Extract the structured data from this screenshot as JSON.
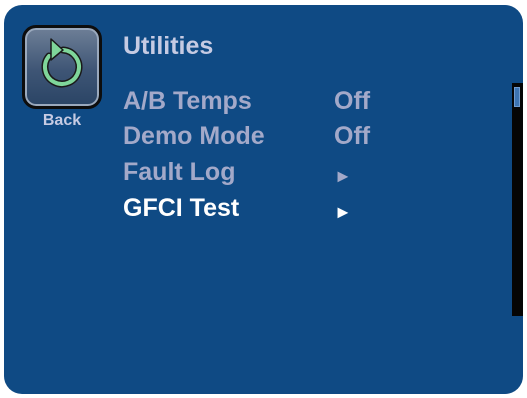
{
  "screen": {
    "title": "Utilities",
    "back": {
      "label": "Back",
      "icon": "back-arrow-icon"
    },
    "menu": [
      {
        "label": "A/B Temps",
        "value": "Off",
        "selected": false
      },
      {
        "label": "Demo Mode",
        "value": "Off",
        "selected": false
      },
      {
        "label": "Fault Log",
        "value": "",
        "arrow": "►",
        "selected": false
      },
      {
        "label": "GFCI Test",
        "value": "",
        "arrow": "►",
        "selected": true
      }
    ]
  },
  "colors": {
    "background": "#0f4a84",
    "text_dim": "#a3a9c9",
    "text_selected": "#ffffff",
    "scrollbar": "#050505"
  }
}
